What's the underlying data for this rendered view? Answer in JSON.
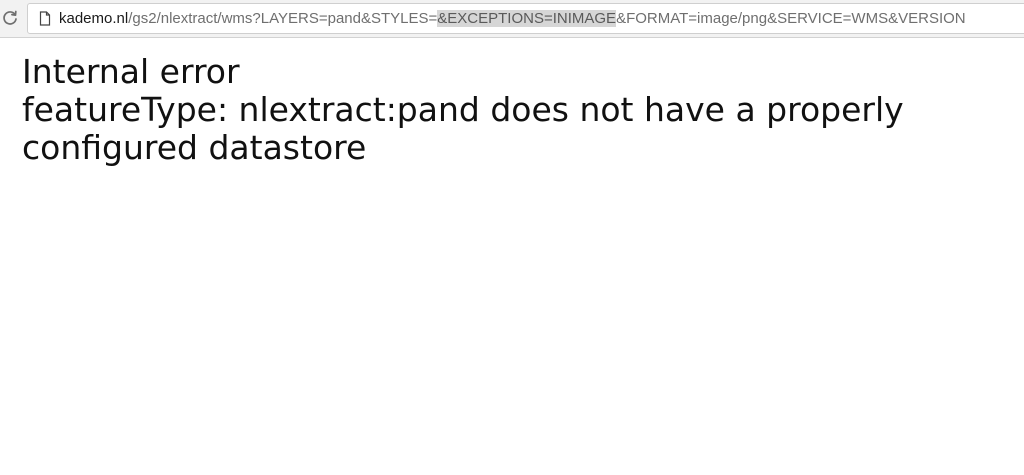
{
  "address_bar": {
    "url_host": "kademo.nl",
    "url_path_before": "/gs2/nlextract/wms?LAYERS=pand&STYLES=",
    "url_highlighted": "&EXCEPTIONS=INIMAGE",
    "url_path_after": "&FORMAT=image/png&SERVICE=WMS&VERSION",
    "reload_icon": "reload-icon",
    "page_icon": "document-icon"
  },
  "error": {
    "title": "Internal error",
    "message_line_1": "featureType: nlextract:pand does not have a properly",
    "message_line_2": "configured datastore"
  },
  "colors": {
    "toolbar_background": "#f2f2f2",
    "url_host": "#1a1a1a",
    "url_path": "#6f6f6f",
    "url_selection": "#d6d6d6",
    "error_text": "#111111",
    "page_background": "#ffffff"
  }
}
